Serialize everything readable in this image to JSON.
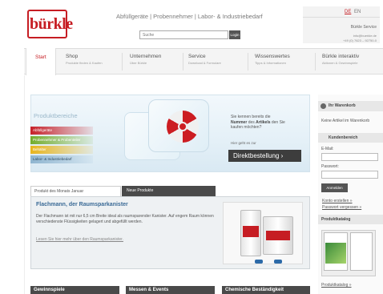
{
  "header": {
    "logo_text": "bürkle",
    "tagline": "Abfüllgeräte | Probennehmer | Labor- & Industriebedarf",
    "search_value": "Suche",
    "search_button": "Login",
    "lang_de": "DE",
    "lang_en": "EN",
    "service_title": "Bürkle Service",
    "service_email": "info@buerkle.de",
    "service_phone": "+49 (0) 7623 – 92750-0"
  },
  "nav": {
    "start": "Start",
    "items": [
      {
        "title": "Shop",
        "sub": "Produkte finden & Kaufen"
      },
      {
        "title": "Unternehmen",
        "sub": "Über Bürkle"
      },
      {
        "title": "Service",
        "sub": "Download & Formulare"
      },
      {
        "title": "Wissenswertes",
        "sub": "Tipps & Informationen"
      },
      {
        "title": "Bürkle interaktiv",
        "sub": "Aktionen & Gewinnspiele"
      }
    ]
  },
  "banner": {
    "heading": "Produktbereiche",
    "categories": [
      "Abfüllgeräte",
      "Probennehmer & Probenteiler",
      "Behälter",
      "Labor- & Industriebedarf"
    ],
    "text_pre": "Sie kennen bereits die",
    "text_bold1": "Nummer",
    "text_mid": "des",
    "text_bold2": "Artikels",
    "text_post": "den Sie kaufen möchten?",
    "subtext": "Hier geht es zur",
    "button": "Direktbestellung ›"
  },
  "tabs": {
    "active": "Produkt des Monats Januar",
    "inactive": "Neue Produkte"
  },
  "product": {
    "title": "Flachmann, der Raumsparkanister",
    "description": "Der Flachmann ist mit nur 6,5 cm Breite ideal als raumsparender Kanister. Auf engem Raum können verschiedenste Flüssigkeiten gelagert und abgefüllt werden.",
    "link": "Lesen Sie hier mehr über den Raumsparkanister."
  },
  "bottom_tabs": [
    "Gewinnspiele",
    "Messen & Events",
    "Chemische Beständigkeit"
  ],
  "sidebar": {
    "cart_title": "Ihr Warenkorb",
    "cart_text": "Keine Artikel im Warenkorb",
    "customer_title": "Kundenbereich",
    "email_label": "E-Mail:",
    "password_label": "Passwort:",
    "login_button": "Anmelden",
    "create_account": "Konto erstellen »",
    "forgot_password": "Passwort vergessen »",
    "catalog_title": "Produktkatalog",
    "catalog_link": "Produktkatalog »"
  },
  "colors": {
    "brand_red": "#c61d23",
    "dark_tab": "#4a4a4a",
    "title_blue": "#3a6a96"
  }
}
